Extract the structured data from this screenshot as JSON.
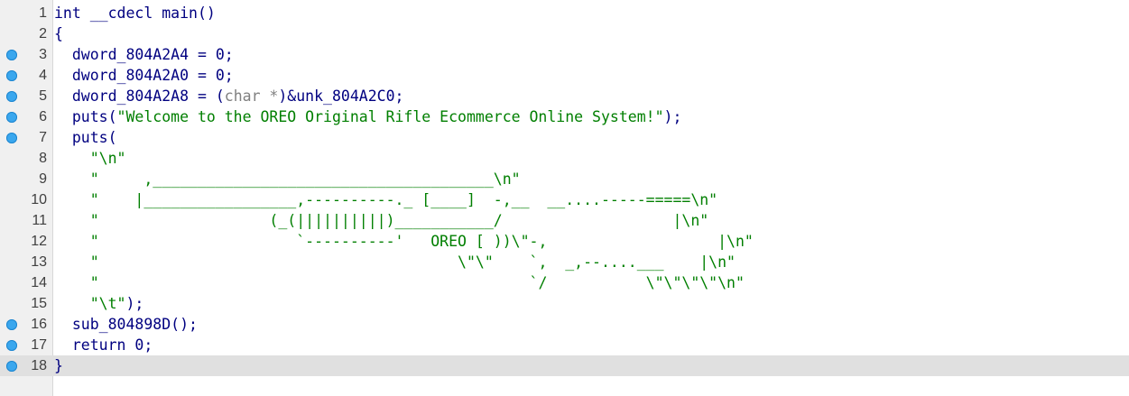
{
  "editor": {
    "lines": [
      {
        "num": "1",
        "bp": false,
        "current": false,
        "indent": "",
        "parts": [
          {
            "t": "int __cdecl main()",
            "c": "ident"
          }
        ]
      },
      {
        "num": "2",
        "bp": false,
        "current": false,
        "indent": "",
        "parts": [
          {
            "t": "{",
            "c": "punct"
          }
        ]
      },
      {
        "num": "3",
        "bp": true,
        "current": false,
        "indent": "  ",
        "parts": [
          {
            "t": "dword_804A2A4 = 0;",
            "c": "ident"
          }
        ]
      },
      {
        "num": "4",
        "bp": true,
        "current": false,
        "indent": "  ",
        "parts": [
          {
            "t": "dword_804A2A0 = 0;",
            "c": "ident"
          }
        ]
      },
      {
        "num": "5",
        "bp": true,
        "current": false,
        "indent": "  ",
        "parts": [
          {
            "t": "dword_804A2A8 = (",
            "c": "ident"
          },
          {
            "t": "char *",
            "c": "tp"
          },
          {
            "t": ")&unk_804A2C0;",
            "c": "ident"
          }
        ]
      },
      {
        "num": "6",
        "bp": true,
        "current": false,
        "indent": "  ",
        "parts": [
          {
            "t": "puts(",
            "c": "ident"
          },
          {
            "t": "\"Welcome to the OREO Original Rifle Ecommerce Online System!\"",
            "c": "str"
          },
          {
            "t": ");",
            "c": "ident"
          }
        ]
      },
      {
        "num": "7",
        "bp": true,
        "current": false,
        "indent": "  ",
        "parts": [
          {
            "t": "puts(",
            "c": "ident"
          }
        ]
      },
      {
        "num": "8",
        "bp": false,
        "current": false,
        "indent": "    ",
        "parts": [
          {
            "t": "\"\\n\"",
            "c": "str"
          }
        ]
      },
      {
        "num": "9",
        "bp": false,
        "current": false,
        "indent": "    ",
        "parts": [
          {
            "t": "\"     ,______________________________________\\n\"",
            "c": "str"
          }
        ]
      },
      {
        "num": "10",
        "bp": false,
        "current": false,
        "indent": "    ",
        "parts": [
          {
            "t": "\"    |_________________,----------._ [____]  -,__  __....-----=====\\n\"",
            "c": "str"
          }
        ]
      },
      {
        "num": "11",
        "bp": false,
        "current": false,
        "indent": "    ",
        "parts": [
          {
            "t": "\"                   (_(||||||||||)___________/                   |\\n\"",
            "c": "str"
          }
        ]
      },
      {
        "num": "12",
        "bp": false,
        "current": false,
        "indent": "    ",
        "parts": [
          {
            "t": "\"                      `----------'   OREO [ ))\\\"-,                   |\\n\"",
            "c": "str"
          }
        ]
      },
      {
        "num": "13",
        "bp": false,
        "current": false,
        "indent": "    ",
        "parts": [
          {
            "t": "\"                                        \\\"\\\"    `,  _,--....___    |\\n\"",
            "c": "str"
          }
        ]
      },
      {
        "num": "14",
        "bp": false,
        "current": false,
        "indent": "    ",
        "parts": [
          {
            "t": "\"                                                `/           \\\"\\\"\\\"\\\"\\n\"",
            "c": "str"
          }
        ]
      },
      {
        "num": "15",
        "bp": false,
        "current": false,
        "indent": "    ",
        "parts": [
          {
            "t": "\"\\t\"",
            "c": "str"
          },
          {
            "t": ");",
            "c": "ident"
          }
        ]
      },
      {
        "num": "16",
        "bp": true,
        "current": false,
        "indent": "  ",
        "parts": [
          {
            "t": "sub_804898D();",
            "c": "ident"
          }
        ]
      },
      {
        "num": "17",
        "bp": true,
        "current": false,
        "indent": "  ",
        "parts": [
          {
            "t": "return 0;",
            "c": "ident"
          }
        ]
      },
      {
        "num": "18",
        "bp": true,
        "current": true,
        "indent": "",
        "parts": [
          {
            "t": "}",
            "c": "punct"
          }
        ]
      }
    ]
  }
}
